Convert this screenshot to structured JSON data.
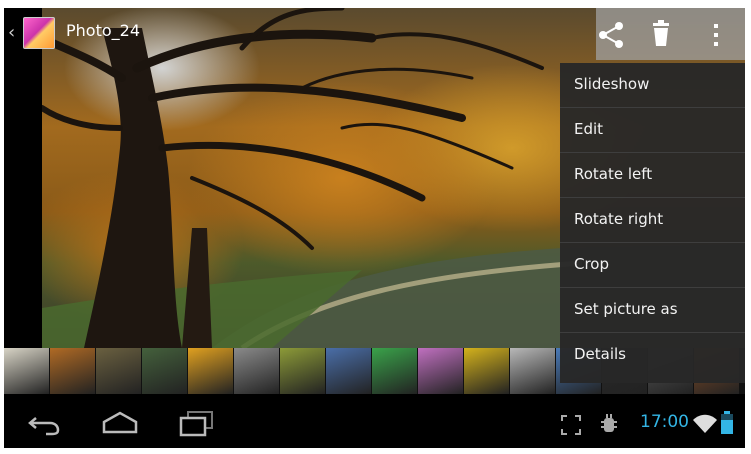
{
  "action_bar": {
    "title": "Photo_24",
    "back_icon": "chevron-left-icon",
    "thumbnail_icon": "gallery-thumbnail-icon",
    "actions": [
      "share-icon",
      "trash-icon",
      "overflow-icon"
    ]
  },
  "overflow_menu": {
    "items": [
      {
        "label": "Slideshow"
      },
      {
        "label": "Edit"
      },
      {
        "label": "Rotate left"
      },
      {
        "label": "Rotate right"
      },
      {
        "label": "Crop"
      },
      {
        "label": "Set picture as"
      },
      {
        "label": "Details"
      }
    ]
  },
  "filmstrip": {
    "thumb_colors": [
      "#d8d4c6",
      "#b06a24",
      "#6a6040",
      "#44603c",
      "#e0a020",
      "#8a8a8a",
      "#8c9a38",
      "#4a6ea8",
      "#3aa24a",
      "#c070c0",
      "#d4b21c",
      "#b8b8b8",
      "#4a7ab8",
      "#2a2a2a",
      "#5a5a5a",
      "#8a5028",
      "#d08a30"
    ]
  },
  "status_bar": {
    "clock": "17:00",
    "clock_color": "#33b5e5",
    "icons": [
      "expand-icon",
      "usb-debug-icon",
      "wifi-icon",
      "battery-icon"
    ]
  },
  "nav_bar": {
    "buttons": [
      "back-nav-icon",
      "home-nav-icon",
      "recents-nav-icon"
    ]
  }
}
